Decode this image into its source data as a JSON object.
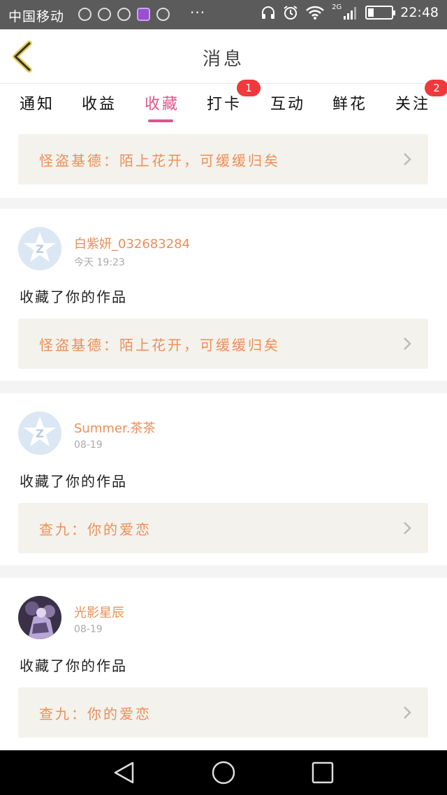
{
  "status_bar": {
    "carrier": "中国移动",
    "more": "···",
    "network": "2G",
    "time": "22:48"
  },
  "header": {
    "title": "消息"
  },
  "tabs": [
    {
      "label": "通知",
      "badge": ""
    },
    {
      "label": "收益",
      "badge": ""
    },
    {
      "label": "收藏",
      "badge": "",
      "active": true
    },
    {
      "label": "打卡",
      "badge": "1"
    },
    {
      "label": "互动",
      "badge": ""
    },
    {
      "label": "鲜花",
      "badge": ""
    },
    {
      "label": "关注",
      "badge": "2"
    }
  ],
  "feed": {
    "top_card": {
      "work_title": "怪盗基德：陌上花开，可缓缓归矣"
    },
    "items": [
      {
        "username": "白紫妍_032683284",
        "time": "今天 19:23",
        "action": "收藏了你的作品",
        "work_title": "怪盗基德：陌上花开，可缓缓归矣",
        "avatar": "default-avatar"
      },
      {
        "username": "Summer.茶茶",
        "time": "08-19",
        "action": "收藏了你的作品",
        "work_title": "查九：你的爱恋",
        "avatar": "default-avatar"
      },
      {
        "username": "光影星辰",
        "time": "08-19",
        "action": "收藏了你的作品",
        "work_title": "查九：你的爱恋",
        "avatar": "photo-avatar"
      }
    ]
  },
  "colors": {
    "accent": "#e0548e",
    "name_orange": "#ee8e57",
    "badge_red": "#f1383c",
    "card_bg": "#f3f2ec"
  }
}
